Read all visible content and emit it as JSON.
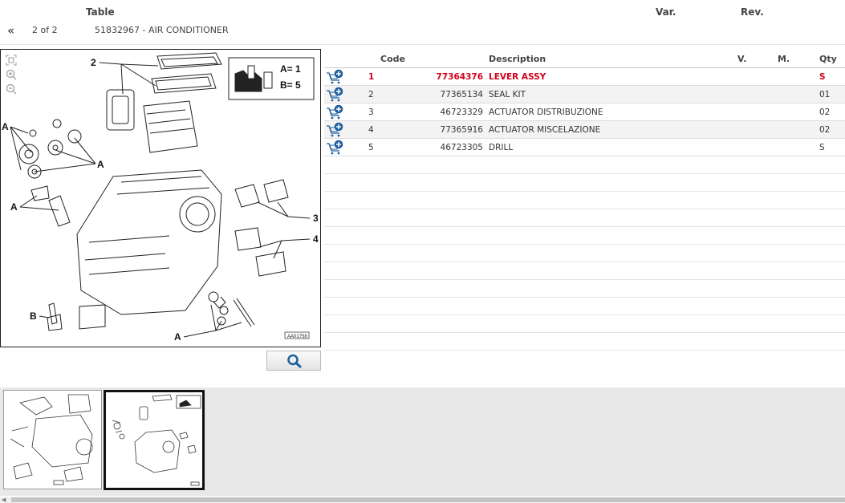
{
  "header": {
    "table_label": "Table",
    "var_label": "Var.",
    "rev_label": "Rev.",
    "prev_symbol": "«",
    "page_info": "2 of 2",
    "table_title": "51832967 - AIR CONDITIONER"
  },
  "diagram": {
    "image_code": "AA01758",
    "labels": {
      "two": "2",
      "three": "3",
      "four": "4",
      "a": "A",
      "b": "B",
      "legend_a": "A= 1",
      "legend_b": "B= 5"
    }
  },
  "parts_table": {
    "columns": {
      "code": "Code",
      "description": "Description",
      "v": "V.",
      "m": "M.",
      "qty": "Qty"
    },
    "rows": [
      {
        "ref": "1",
        "code": "77364376",
        "description": "LEVER ASSY",
        "v": "",
        "m": "",
        "qty": "S",
        "selected": true
      },
      {
        "ref": "2",
        "code": "77365134",
        "description": "SEAL KIT",
        "v": "",
        "m": "",
        "qty": "01",
        "selected": false
      },
      {
        "ref": "3",
        "code": "46723329",
        "description": "ACTUATOR DISTRIBUZIONE",
        "v": "",
        "m": "",
        "qty": "02",
        "selected": false
      },
      {
        "ref": "4",
        "code": "77365916",
        "description": "ACTUATOR MISCELAZIONE",
        "v": "",
        "m": "",
        "qty": "02",
        "selected": false
      },
      {
        "ref": "5",
        "code": "46723305",
        "description": "DRILL",
        "v": "",
        "m": "",
        "qty": "S",
        "selected": false
      }
    ]
  },
  "icons": {
    "prev": "double-chevron-left-icon",
    "cart": "add-to-cart-icon",
    "search": "magnifier-icon",
    "zoom_fit": "zoom-fit-icon",
    "zoom_in": "zoom-in-icon",
    "zoom_out": "zoom-out-icon"
  },
  "colors": {
    "selected_row_text": "#d0021b",
    "cart_icon": "#1f5f9e",
    "search_icon": "#1f5f9e",
    "thumbnail_strip": "#e8e8e8"
  }
}
